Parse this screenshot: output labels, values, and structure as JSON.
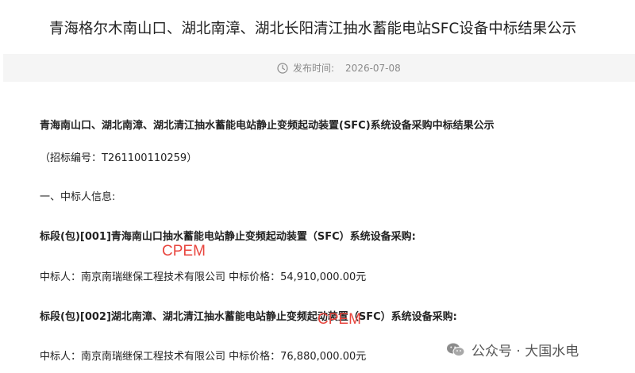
{
  "article": {
    "title": "青海格尔木南山口、湖北南漳、湖北长阳清江抽水蓄能电站SFC设备中标结果公示",
    "publish_label": "发布时间:",
    "publish_date": "2026-07-08"
  },
  "content": {
    "headline": "青海南山口、湖北南漳、湖北清江抽水蓄能电站静止变频起动装置(SFC)系统设备采购中标结果公示",
    "tender_no": "（招标编号：T261100110259）",
    "section1": "一、中标人信息:",
    "lot1_title": "标段(包)[001]青海南山口抽水蓄能电站静止变频起动装置（SFC）系统设备采购:",
    "lot1_winner": "中标人：南京南瑞继保工程技术有限公司 中标价格：54,910,000.00元",
    "lot2_title": "标段(包)[002]湖北南漳、湖北清江抽水蓄能电站静止变频起动装置（SFC）系统设备采购:",
    "lot2_winner": "中标人：南京南瑞继保工程技术有限公司 中标价格：76,880,000.00元"
  },
  "watermarks": {
    "cpem_1": "CPEM",
    "cpem_2": "CPEM",
    "account": "公众号 · 大国水电"
  },
  "colors": {
    "watermark_red": "#e8463f",
    "meta_gray": "#8a8a8a",
    "meta_bg": "#f5f5f5"
  },
  "icons": {
    "meta": "clock-icon",
    "account": "wechat-icon"
  }
}
